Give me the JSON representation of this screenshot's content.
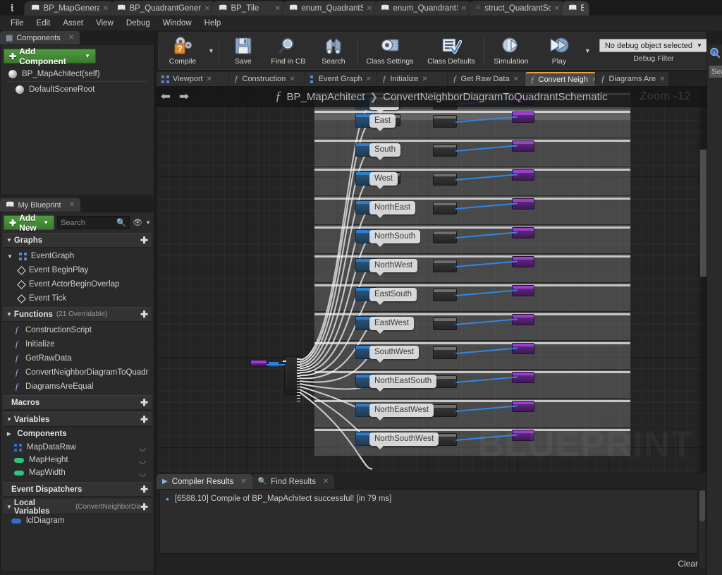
{
  "window": {
    "logo": "unreal-logo",
    "asset_tabs": [
      {
        "label": "BP_MapGenerator",
        "icon": "blueprint-icon",
        "active": false
      },
      {
        "label": "BP_QuadrantGenerator",
        "icon": "blueprint-icon",
        "active": false
      },
      {
        "label": "BP_Tile",
        "icon": "blueprint-icon",
        "active": false
      },
      {
        "label": "enum_QuadrantShape",
        "icon": "enum-icon",
        "active": false
      },
      {
        "label": "enum_QuandrantSpecia",
        "icon": "enum-icon",
        "active": false
      },
      {
        "label": "struct_QuadrantSchema",
        "icon": "struct-icon",
        "active": false
      },
      {
        "label": "BP",
        "icon": "blueprint-icon",
        "active": true
      }
    ]
  },
  "menubar": {
    "items": [
      "File",
      "Edit",
      "Asset",
      "View",
      "Debug",
      "Window",
      "Help"
    ]
  },
  "toolbar": {
    "buttons": [
      {
        "label": "Compile",
        "icon": "compile-question-icon",
        "has_caret": true
      },
      {
        "label": "Save",
        "icon": "save-floppy-icon",
        "has_caret": false
      },
      {
        "label": "Find in CB",
        "icon": "magnifier-icon",
        "has_caret": false
      },
      {
        "label": "Search",
        "icon": "binoculars-icon",
        "has_caret": false
      },
      {
        "label": "Class Settings",
        "icon": "class-settings-gear-icon",
        "has_caret": false
      },
      {
        "label": "Class Defaults",
        "icon": "class-defaults-checklist-icon",
        "has_caret": false
      },
      {
        "label": "Simulation",
        "icon": "simulation-gear-play-icon",
        "has_caret": false
      },
      {
        "label": "Play",
        "icon": "play-gear-icon",
        "has_caret": true
      }
    ],
    "debug_filter": {
      "value": "No debug object selected",
      "label": "Debug Filter"
    }
  },
  "components_panel": {
    "tab_label": "Components",
    "tab_icon": "components-icon",
    "add_button": "Add Component",
    "items": [
      {
        "label": "BP_MapAchitect(self)",
        "icon": "sphere-icon"
      },
      {
        "label": "DefaultSceneRoot",
        "icon": "scene-root-icon"
      }
    ]
  },
  "my_blueprint_panel": {
    "tab_label": "My Blueprint",
    "tab_icon": "blueprint-icon",
    "add_button": "Add New",
    "search_placeholder": "Search",
    "sections": [
      {
        "title": "Graphs",
        "subtitle": "",
        "collapsed": false,
        "rows": [
          {
            "label": "EventGraph",
            "icon": "event-graph-icon",
            "depth": 0
          },
          {
            "label": "Event BeginPlay",
            "icon": "event-node-icon",
            "depth": 1
          },
          {
            "label": "Event ActorBeginOverlap",
            "icon": "event-node-icon",
            "depth": 1
          },
          {
            "label": "Event Tick",
            "icon": "event-node-icon",
            "depth": 1
          }
        ]
      },
      {
        "title": "Functions",
        "subtitle": "(21 Overridable)",
        "collapsed": false,
        "rows": [
          {
            "label": "ConstructionScript",
            "icon": "construction-script-icon",
            "depth": 1
          },
          {
            "label": "Initialize",
            "icon": "function-icon",
            "depth": 1
          },
          {
            "label": "GetRawData",
            "icon": "function-icon",
            "depth": 1
          },
          {
            "label": "ConvertNeighborDiagramToQuadr",
            "icon": "function-icon",
            "depth": 1
          },
          {
            "label": "DiagramsAreEqual",
            "icon": "function-icon",
            "depth": 1
          }
        ]
      },
      {
        "title": "Macros",
        "subtitle": "",
        "collapsed": true,
        "rows": []
      },
      {
        "title": "Variables",
        "subtitle": "",
        "collapsed": false,
        "rows": []
      }
    ],
    "variables_group": "Components",
    "variables": [
      {
        "label": "MapDataRaw",
        "icon": "array-icon",
        "color": "#2f6fd0"
      },
      {
        "label": "MapHeight",
        "icon": "int-pill-icon",
        "color": "#2ec27e"
      },
      {
        "label": "MapWidth",
        "icon": "int-pill-icon",
        "color": "#2ec27e"
      }
    ],
    "event_dispatchers_title": "Event Dispatchers",
    "local_variables_title": "Local Variables",
    "local_variables_subtitle": "(ConvertNeighborDiag",
    "local_variables": [
      {
        "label": "lclDiagram",
        "icon": "struct-pill-icon",
        "color": "#2f6fd0"
      }
    ]
  },
  "graph_tabs": [
    {
      "label": "Viewport",
      "icon": "viewport-icon",
      "active": false
    },
    {
      "label": "Construction",
      "icon": "function-icon",
      "active": false
    },
    {
      "label": "Event Graph",
      "icon": "event-graph-icon",
      "active": false
    },
    {
      "label": "Initialize",
      "icon": "function-icon",
      "active": false
    },
    {
      "label": "Get Raw Data",
      "icon": "function-icon",
      "active": false
    },
    {
      "label": "Convert Neigh",
      "icon": "function-icon",
      "active": true
    },
    {
      "label": "Diagrams Are",
      "icon": "function-icon",
      "active": false
    }
  ],
  "graph": {
    "back_arrow": "⬅",
    "forward_arrow": "➡",
    "breadcrumb_root": "BP_MapAchitect",
    "breadcrumb_separator": "❯",
    "breadcrumb_current": "ConvertNeighborDiagramToQuadrantSchematic",
    "zoom_label": "Zoom -12",
    "watermark": "BLUEPRINT",
    "node_labels": [
      "North",
      "East",
      "South",
      "West",
      "NorthEast",
      "NorthSouth",
      "NorthWest",
      "EastSouth",
      "EastWest",
      "SouthWest",
      "NorthEastSouth",
      "NorthEastWest",
      "NorthSouthWest"
    ]
  },
  "details_panel": {
    "icon": "details-search-icon",
    "search_placeholder": "Sea"
  },
  "bottom_panel": {
    "tabs": [
      {
        "label": "Compiler Results",
        "icon": "compiler-results-icon",
        "active": true
      },
      {
        "label": "Find Results",
        "icon": "magnifier-icon",
        "active": false
      }
    ],
    "log_lines": [
      "[6588.10] Compile of BP_MapAchitect successful! [in 79 ms]"
    ],
    "clear_button": "Clear"
  },
  "colors": {
    "accent_orange": "#e8a33d",
    "add_green": "#4e9b3f",
    "exec_wire": "#e8e8e8",
    "data_wire_blue": "#2f86e0",
    "data_wire_red": "#a83030",
    "panel_bg": "#2a2a2a",
    "graph_bg": "#242424"
  }
}
